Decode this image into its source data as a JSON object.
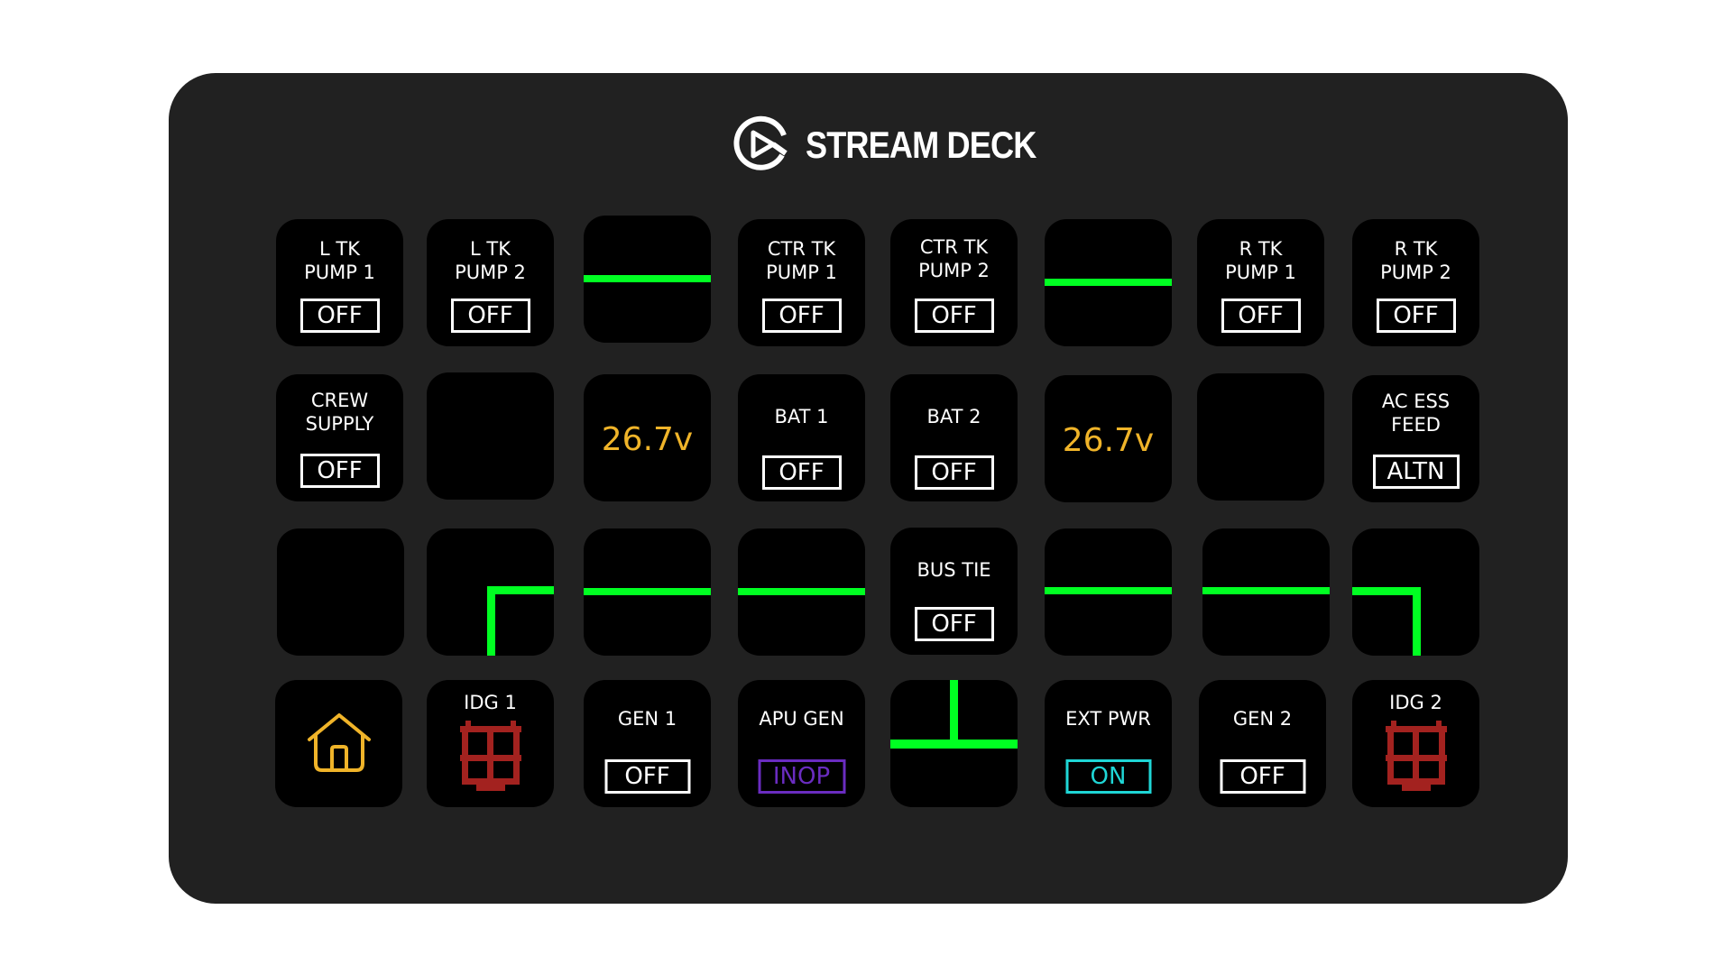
{
  "device": {
    "brand": "STREAM DECK",
    "logo_icon": "elgato-logo-icon"
  },
  "colors": {
    "bus_line": "#00ff22",
    "voltage": "#f0b429",
    "switch_off": "#ffffff",
    "switch_on": "#1fd6d6",
    "switch_inop": "#6a2cc0",
    "idg_icon": "#a3221f",
    "home_icon": "#f0b429"
  },
  "keys": {
    "r1c1": {
      "label": "L TK\nPUMP 1",
      "state": "OFF"
    },
    "r1c2": {
      "label": "L TK\nPUMP 2",
      "state": "OFF"
    },
    "r1c4": {
      "label": "CTR TK\nPUMP 1",
      "state": "OFF"
    },
    "r1c5": {
      "label": "CTR TK\nPUMP 2",
      "state": "OFF"
    },
    "r1c7": {
      "label": "R TK\nPUMP 1",
      "state": "OFF"
    },
    "r1c8": {
      "label": "R TK\nPUMP 2",
      "state": "OFF"
    },
    "r2c1": {
      "label": "CREW\nSUPPLY",
      "state": "OFF"
    },
    "r2c3": {
      "value": "26.7v"
    },
    "r2c4": {
      "label": "BAT 1",
      "state": "OFF"
    },
    "r2c5": {
      "label": "BAT 2",
      "state": "OFF"
    },
    "r2c6": {
      "value": "26.7v"
    },
    "r2c8": {
      "label": "AC ESS\nFEED",
      "state": "ALTN"
    },
    "r3c5": {
      "label": "BUS TIE",
      "state": "OFF"
    },
    "r4c1": {
      "icon": "home-icon"
    },
    "r4c2": {
      "label": "IDG 1",
      "icon": "idg-disconnect-icon"
    },
    "r4c3": {
      "label": "GEN 1",
      "state": "OFF"
    },
    "r4c4": {
      "label": "APU GEN",
      "state": "INOP"
    },
    "r4c6": {
      "label": "EXT PWR",
      "state": "ON"
    },
    "r4c7": {
      "label": "GEN 2",
      "state": "OFF"
    },
    "r4c8": {
      "label": "IDG 2",
      "icon": "idg-disconnect-icon"
    }
  }
}
